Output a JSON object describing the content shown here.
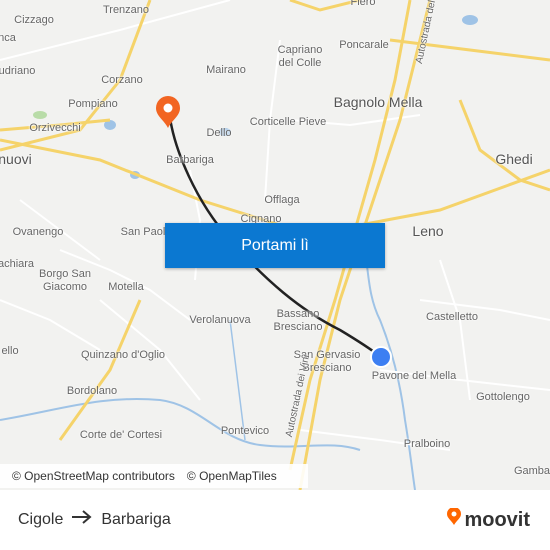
{
  "colors": {
    "road_major": "#f5d36a",
    "road_minor": "#ffffff",
    "water": "#9fc3e6",
    "route_line": "#222222",
    "origin_marker": "#3d7ff2",
    "destination_marker": "#f26522",
    "cta_background": "#0b78d1",
    "brand_accent": "#ff6600"
  },
  "map": {
    "places": [
      {
        "name": "Trenzano"
      },
      {
        "name": "Cizzago"
      },
      {
        "name": "nca"
      },
      {
        "name": "udriano"
      },
      {
        "name": "Corzano"
      },
      {
        "name": "Mairano"
      },
      {
        "name": "Capriano\ndel Colle"
      },
      {
        "name": "Poncarale"
      },
      {
        "name": "Bagnolo Mella"
      },
      {
        "name": "Pompiano"
      },
      {
        "name": "Orzivecchi"
      },
      {
        "name": "nuovi"
      },
      {
        "name": "Dello"
      },
      {
        "name": "Corticelle Pieve"
      },
      {
        "name": "Barbariga"
      },
      {
        "name": "Ghedi"
      },
      {
        "name": "Offlaga"
      },
      {
        "name": "Cignano"
      },
      {
        "name": "Ovanengo"
      },
      {
        "name": "San Paolo"
      },
      {
        "name": "Leno"
      },
      {
        "name": "achiara"
      },
      {
        "name": "Borgo San\nGiacomo"
      },
      {
        "name": "Motella"
      },
      {
        "name": "Verolanuova"
      },
      {
        "name": "Bassano\nBresciano"
      },
      {
        "name": "Castelletto"
      },
      {
        "name": "ello"
      },
      {
        "name": "Quinzano d'Oglio"
      },
      {
        "name": "San Gervasio\nBresciano"
      },
      {
        "name": "Pavone del Mella"
      },
      {
        "name": "Bordolano"
      },
      {
        "name": "Gottolengo"
      },
      {
        "name": "Corte de' Cortesi"
      },
      {
        "name": "Pontevico"
      },
      {
        "name": "Pralboino"
      },
      {
        "name": "Gamba"
      },
      {
        "name": "Flero"
      },
      {
        "name": "Autostrada dei Vini"
      },
      {
        "name": "Autostrada del"
      }
    ],
    "cta_label": "Portami lì",
    "attribution": [
      "© OpenStreetMap contributors",
      "© OpenMapTiles"
    ]
  },
  "footer": {
    "origin": "Cigole",
    "destination": "Barbariga",
    "brand": "moovit"
  }
}
